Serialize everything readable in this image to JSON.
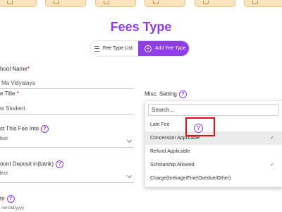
{
  "title": "Fees Type",
  "toggle": {
    "list_label": "Fee Type List",
    "add_label": "Add Fee Type"
  },
  "form": {
    "school_name_label": "hool Name",
    "school_name_value": "Ma Vidyalaya",
    "fee_title_label": "e Title",
    "fee_title_value": "w Student",
    "misc_setting_label": "Misc. Setting",
    "post_fee_label": "st This Fee Into",
    "post_fee_value": "lect",
    "account_deposit_label": "ount Deposit in(bank)",
    "account_deposit_value": "lect",
    "date_label": "te",
    "date_hint": "mm/dd/yyyy",
    "required_mark": "*"
  },
  "dropdown": {
    "search_placeholder": "Search...",
    "options": [
      {
        "label": "Late Fee",
        "selected": false,
        "checked": false
      },
      {
        "label": "Concession Applicable",
        "selected": true,
        "checked": true
      },
      {
        "label": "Refund Applicable",
        "selected": false,
        "checked": false
      },
      {
        "label": "Scholarship Allowed",
        "selected": false,
        "checked": true
      },
      {
        "label": "Charge(brekage/Fine/Ovedue/Other)",
        "selected": false,
        "checked": false
      }
    ],
    "check_glyph": "✓"
  },
  "colors": {
    "accent": "#8f3ee6",
    "required": "#d00000",
    "top_tab": "#fbe3bd",
    "highlight_box": "#e01010"
  },
  "icons": {
    "help": "?",
    "plus": "+"
  }
}
